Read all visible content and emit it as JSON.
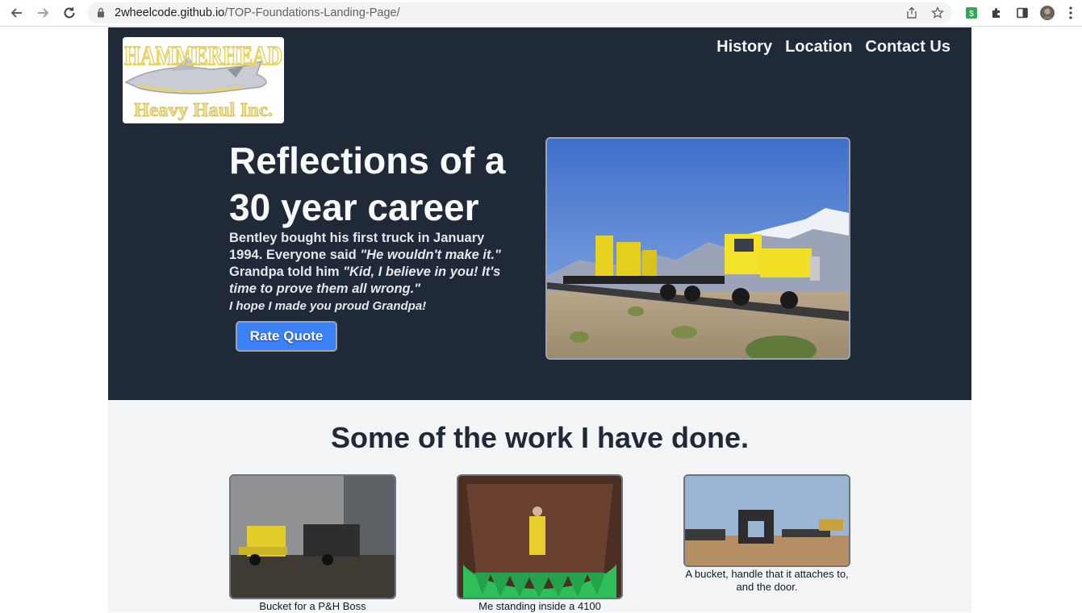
{
  "browser": {
    "url_host": "2wheelcode.github.io",
    "url_path": "/TOP-Foundations-Landing-Page/",
    "icons": [
      "back-icon",
      "forward-icon",
      "reload-icon",
      "lock-icon",
      "share-icon",
      "bookmark-star-icon",
      "extension-dollar-icon",
      "extensions-puzzle-icon",
      "side-panel-icon",
      "profile-avatar",
      "menu-kebab-icon"
    ]
  },
  "header": {
    "logo_text_top": "HAMMERHEAD",
    "logo_text_bottom": "Heavy Haul Inc.",
    "nav": [
      "History",
      "Location",
      "Contact Us"
    ]
  },
  "hero": {
    "title": "Reflections of a 30 year career",
    "intro_1": "Bentley bought his first truck in January 1994. Everyone said ",
    "quote_1": "\"He wouldn't make it.\"",
    "intro_2": " Grandpa told him ",
    "quote_2": "\"Kid, I believe in you! It's time to prove them all wrong.\"",
    "signoff": "I hope I made you proud Grandpa!",
    "cta_label": "Rate Quote"
  },
  "work": {
    "title": "Some of the work I have done.",
    "cards": [
      {
        "caption": "Bucket for a P&H Boss"
      },
      {
        "caption": "Me standing inside a 4100"
      },
      {
        "caption": "A bucket, handle that it attaches to, and the door."
      }
    ]
  },
  "colors": {
    "hero_bg": "#1f2937",
    "section_bg": "#f3f4f6",
    "cta": "#3b82f6",
    "logo_yellow": "#e8d36a"
  }
}
